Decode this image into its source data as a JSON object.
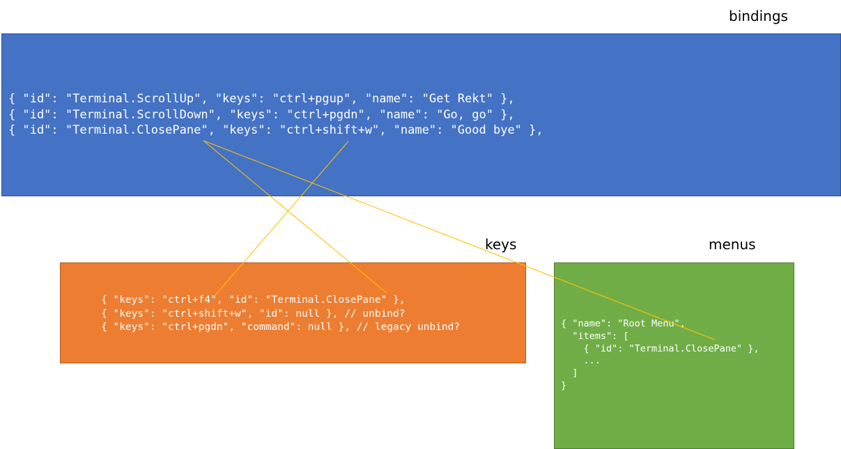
{
  "labels": {
    "bindings": "bindings",
    "keys": "keys",
    "menus": "menus"
  },
  "colors": {
    "bindings_fill": "#4472c4",
    "keys_fill": "#ed7d31",
    "menus_fill": "#70ad47",
    "connector": "#ffc000",
    "code_text": "#ffffff"
  },
  "bindings": {
    "lines": [
      "{ \"id\": \"Terminal.ScrollUp\", \"keys\": \"ctrl+pgup\", \"name\": \"Get Rekt\" },",
      "{ \"id\": \"Terminal.ScrollDown\", \"keys\": \"ctrl+pgdn\", \"name\": \"Go, go\" },",
      "{ \"id\": \"Terminal.ClosePane\", \"keys\": \"ctrl+shift+w\", \"name\": \"Good bye\" },"
    ]
  },
  "keys": {
    "lines": [
      "{ \"keys\": \"ctrl+f4\", \"id\": \"Terminal.ClosePane\" },",
      "{ \"keys\": \"ctrl+shift+w\", \"id\": null }, // unbind?",
      "{ \"keys\": \"ctrl+pgdn\", \"command\": null }, // legacy unbind?"
    ]
  },
  "menus": {
    "lines": [
      "{ \"name\": \"Root Menu\",",
      "  \"items\": [",
      "    { \"id\": \"Terminal.ClosePane\" },",
      "    ...",
      "  ]",
      "}"
    ]
  }
}
